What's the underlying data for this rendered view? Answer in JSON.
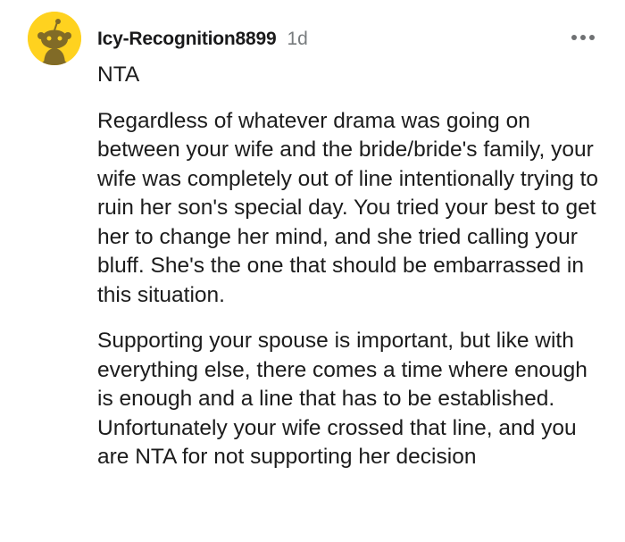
{
  "comment": {
    "author": "Icy-Recognition8899",
    "age": "1d",
    "avatar_icon": "snoo-avatar-icon",
    "avatar_color": "#ffd21f",
    "menu_icon": "more-options-icon",
    "paragraphs": [
      "NTA",
      "Regardless of whatever drama was going on between your wife and the bride/bride's family, your wife was completely out of line intentionally trying to ruin her son's special day. You tried your best to get her to change her mind, and she tried calling your bluff. She's the one that should be embarrassed in this situation.",
      "Supporting your spouse is important, but like with everything else, there comes a time where enough is enough and a line that has to be established. Unfortunately your wife crossed that line, and you are NTA for not supporting her decision"
    ]
  }
}
